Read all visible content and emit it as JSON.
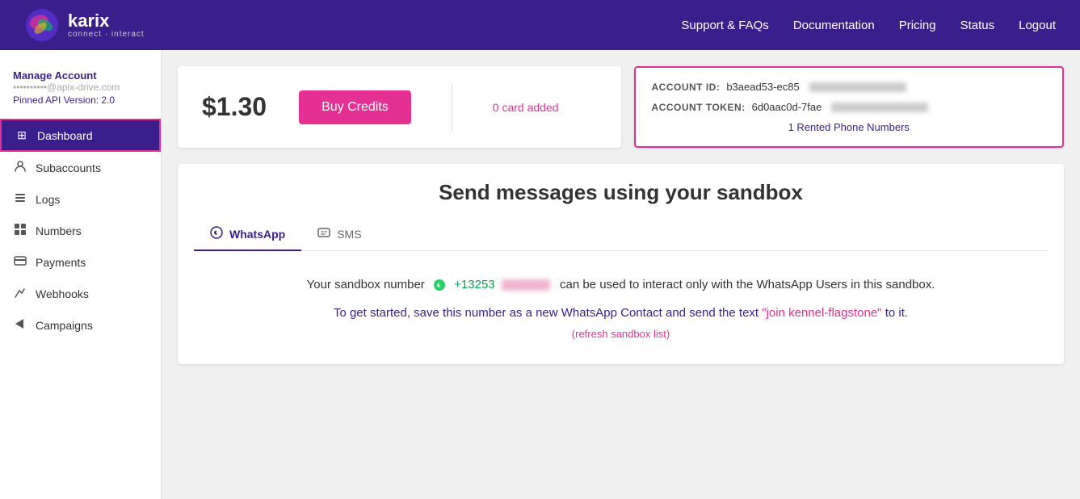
{
  "header": {
    "logo_text": "karix",
    "logo_sub": "connect · interact",
    "nav": [
      {
        "label": "Support & FAQs",
        "key": "support"
      },
      {
        "label": "Documentation",
        "key": "docs"
      },
      {
        "label": "Pricing",
        "key": "pricing"
      },
      {
        "label": "Status",
        "key": "status"
      },
      {
        "label": "Logout",
        "key": "logout"
      }
    ]
  },
  "sidebar": {
    "manage_account": "Manage Account",
    "email_prefix": "••••••••••@apix-",
    "email_domain": "drive.com",
    "pinned_api": "Pinned API Version: 2.0",
    "items": [
      {
        "label": "Dashboard",
        "icon": "⊞",
        "key": "dashboard",
        "active": true
      },
      {
        "label": "Subaccounts",
        "icon": "👤",
        "key": "subaccounts"
      },
      {
        "label": "Logs",
        "icon": "☰",
        "key": "logs"
      },
      {
        "label": "Numbers",
        "icon": "⊞",
        "key": "numbers"
      },
      {
        "label": "Payments",
        "icon": "▤",
        "key": "payments"
      },
      {
        "label": "Webhooks",
        "icon": "✈",
        "key": "webhooks"
      },
      {
        "label": "Campaigns",
        "icon": "⚡",
        "key": "campaigns"
      }
    ]
  },
  "balance_card": {
    "amount": "$1.30",
    "buy_credits_label": "Buy Credits",
    "card_added": "0 card added"
  },
  "account_info": {
    "account_id_label": "ACCOUNT ID:",
    "account_id_value": "b3aead53-ec85",
    "account_token_label": "ACCOUNT TOKEN:",
    "account_token_value": "6d0aac0d-7fae",
    "rented_numbers": "1 Rented Phone Numbers"
  },
  "sandbox": {
    "title": "Send messages using your sandbox",
    "tabs": [
      {
        "label": "WhatsApp",
        "key": "whatsapp",
        "active": true
      },
      {
        "label": "SMS",
        "key": "sms"
      }
    ],
    "line1_pre": "Your sandbox number",
    "sandbox_number_prefix": "+13253",
    "line1_post": "can be used to interact only with the WhatsApp Users in this sandbox.",
    "line2": "To get started, save this number as a new WhatsApp Contact and send the text",
    "join_code": "\"join kennel-flagstone\"",
    "line2_post": "to it.",
    "refresh_link": "(refresh sandbox list)"
  }
}
